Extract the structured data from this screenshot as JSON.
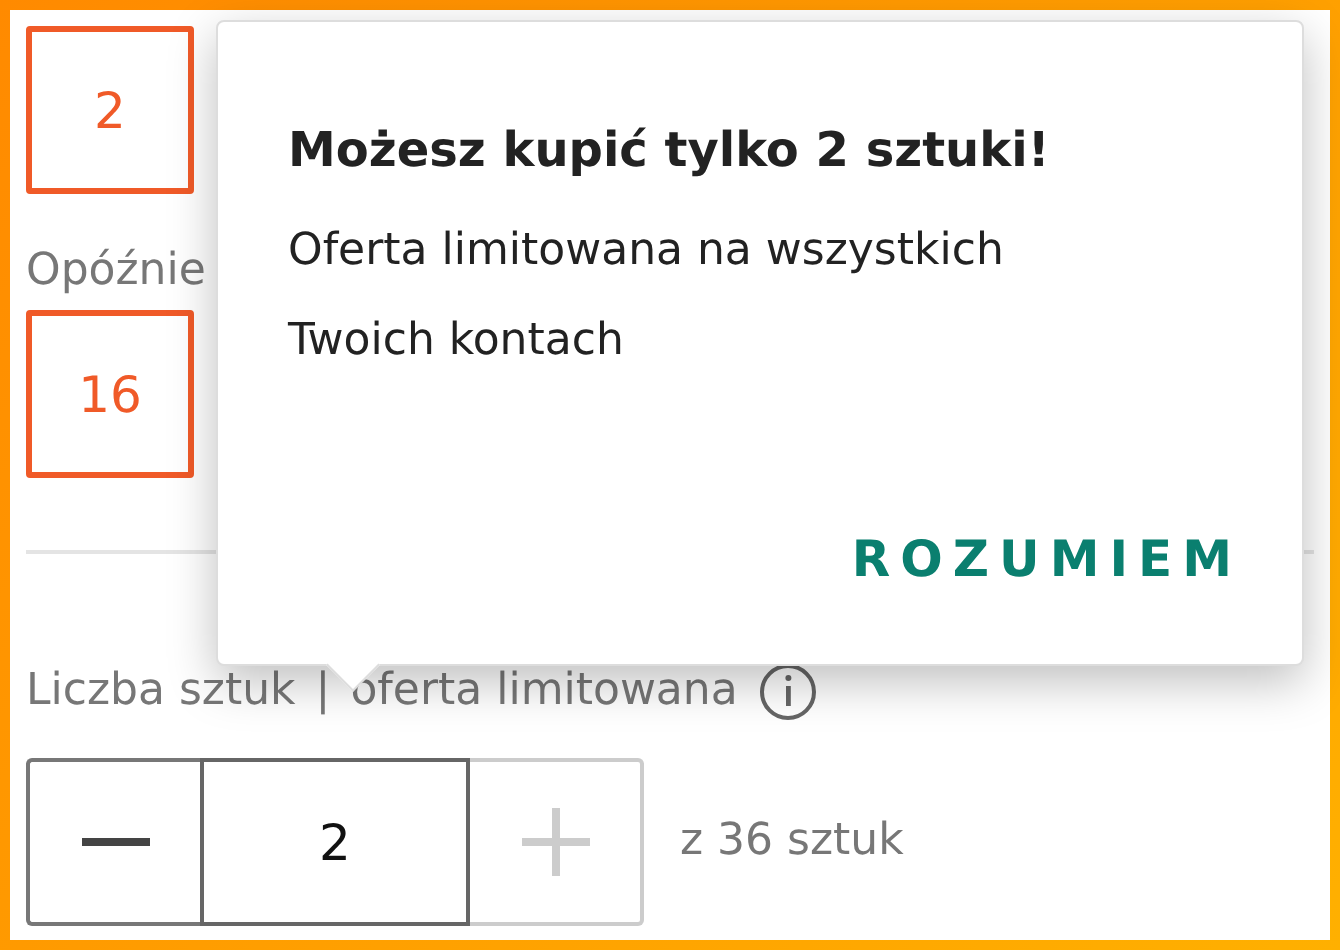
{
  "fields": [
    {
      "value": "2"
    },
    {
      "label": "Opóźnie",
      "value": "16"
    }
  ],
  "quantity": {
    "label": "Liczba sztuk",
    "separator": "|",
    "note": "oferta limitowana",
    "buttons": [
      {
        "kind": "minus",
        "disabled": false
      },
      {
        "kind": "plus",
        "disabled": true
      }
    ],
    "value": "2",
    "total": "z 36 sztuk"
  },
  "popover": {
    "title": "Możesz kupić tylko 2 sztuki!",
    "body": "Oferta limitowana na wszystkich Twoich kontach",
    "button": "ROZUMIEM"
  }
}
